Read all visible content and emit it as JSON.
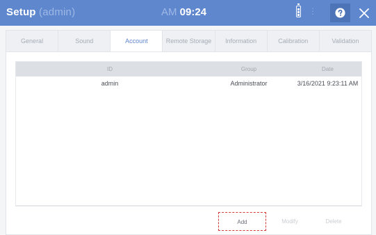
{
  "titlebar": {
    "title": "Setup",
    "user": "(admin)",
    "ampm": "AM",
    "time": "09:24"
  },
  "tabs": [
    {
      "label": "General",
      "active": false
    },
    {
      "label": "Sound",
      "active": false
    },
    {
      "label": "Account",
      "active": true
    },
    {
      "label": "Remote Storage",
      "active": false
    },
    {
      "label": "Information",
      "active": false
    },
    {
      "label": "Calibration",
      "active": false
    },
    {
      "label": "Validation",
      "active": false
    }
  ],
  "table": {
    "columns": [
      "ID",
      "Group",
      "Date"
    ],
    "rows": [
      {
        "id": "admin",
        "group": "Administrator",
        "date": "3/16/2021 9:23:11 AM"
      }
    ]
  },
  "buttons": {
    "add": "Add",
    "modify": "Modify",
    "delete": "Delete"
  },
  "colors": {
    "titlebar": "#5f87ce",
    "accent": "#5e85ca",
    "highlight": "#d23a3a"
  },
  "icons": [
    "battery-icon",
    "help-icon",
    "close-icon"
  ]
}
